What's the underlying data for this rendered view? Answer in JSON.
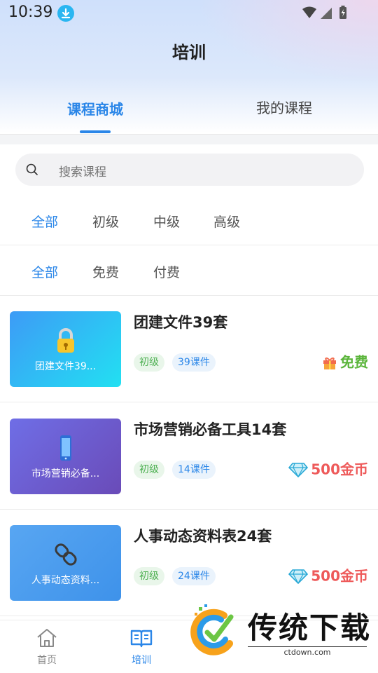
{
  "status_bar": {
    "time": "10:39"
  },
  "header": {
    "title": "培训"
  },
  "tabs": [
    {
      "label": "课程商城",
      "active": true
    },
    {
      "label": "我的课程",
      "active": false
    }
  ],
  "search": {
    "placeholder": "搜索课程"
  },
  "level_filters": [
    "全部",
    "初级",
    "中级",
    "高级"
  ],
  "price_filters": [
    "全部",
    "免费",
    "付费"
  ],
  "courses": [
    {
      "title": "团建文件39套",
      "thumb_text": "团建文件39...",
      "thumb_icon": "lock-icon",
      "level": "初级",
      "lessons": "39课件",
      "price": "免费",
      "price_icon": "gift-icon"
    },
    {
      "title": "市场营销必备工具14套",
      "thumb_text": "市场营销必备...",
      "thumb_icon": "phone-icon",
      "level": "初级",
      "lessons": "14课件",
      "price": "500金币",
      "price_icon": "diamond-icon"
    },
    {
      "title": "人事动态资料表24套",
      "thumb_text": "人事动态资料...",
      "thumb_icon": "chain-link-icon",
      "level": "初级",
      "lessons": "24课件",
      "price": "500金币",
      "price_icon": "diamond-icon"
    }
  ],
  "bottom_nav": [
    {
      "label": "首页",
      "icon": "home-icon",
      "active": false
    },
    {
      "label": "培训",
      "icon": "book-icon",
      "active": true
    }
  ],
  "watermark": {
    "text": "传统下载",
    "url": "ctdown.com"
  },
  "colors": {
    "accent": "#2a86e8",
    "free": "#5ab53a",
    "paid": "#ee5a5a",
    "level_tag": "#4caf50"
  }
}
